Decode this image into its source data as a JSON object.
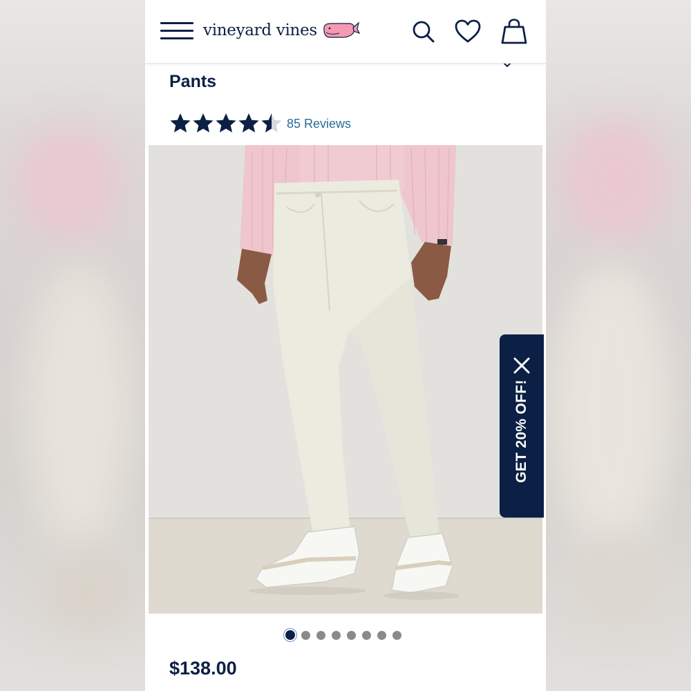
{
  "brand": {
    "name": "vineyard vines",
    "whale_color": "#f29bb3"
  },
  "header": {
    "menu_icon": "hamburger-menu-icon",
    "search_icon": "search-icon",
    "wishlist_icon": "heart-icon",
    "bag_icon": "shopping-bag-icon"
  },
  "product": {
    "title_visible": "Pants",
    "rating": 4.5,
    "rating_max": 5,
    "reviews_label": "85 Reviews",
    "price": "$138.00"
  },
  "gallery": {
    "image_count": 8,
    "active_index": 0
  },
  "promo": {
    "label": "GET 20% OFF!",
    "close_icon": "close-icon"
  },
  "colors": {
    "navy": "#0c1f45",
    "link": "#2a6b9a",
    "dot_inactive": "#8a8a8a"
  }
}
